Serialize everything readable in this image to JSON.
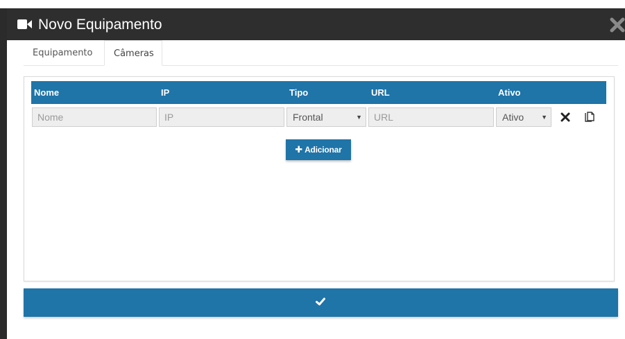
{
  "modal": {
    "title": "Novo Equipamento",
    "title_icon": "video-camera-icon",
    "close_icon": "close-icon"
  },
  "tabs": [
    {
      "label": "Equipamento",
      "active": false
    },
    {
      "label": "Câmeras",
      "active": true
    }
  ],
  "table": {
    "columns": [
      "Nome",
      "IP",
      "Tipo",
      "URL",
      "Ativo"
    ],
    "row": {
      "nome_placeholder": "Nome",
      "ip_placeholder": "IP",
      "tipo_value": "Frontal",
      "url_placeholder": "URL",
      "ativo_value": "Ativo",
      "remove_icon": "remove-icon",
      "copy_icon": "copy-icon"
    }
  },
  "add_button": {
    "label": "Adicionar",
    "icon": "plus-icon"
  },
  "confirm_button": {
    "icon": "check-icon"
  },
  "colors": {
    "header_bg": "#2e2e2e",
    "accent": "#1f74a8",
    "field_bg": "#eeeeee"
  }
}
